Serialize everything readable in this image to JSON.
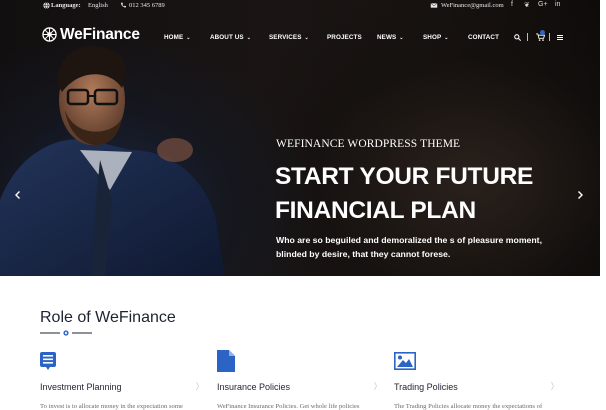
{
  "topbar": {
    "language_label": "Language:",
    "language_value": "English",
    "phone": "012 345 6789",
    "email": "WeFinance@gmail.com",
    "social_icons": [
      "facebook-icon",
      "twitter-icon",
      "google-plus-icon",
      "linkedin-icon"
    ],
    "social_glyphs": [
      "f",
      "❦",
      "G+",
      "in"
    ]
  },
  "brand": {
    "name": "WeFinance"
  },
  "nav": {
    "items": [
      {
        "label": "HOME",
        "caret": "⌄"
      },
      {
        "label": "ABOUT US",
        "caret": "⌄"
      },
      {
        "label": "SERVICES",
        "caret": "⌄"
      },
      {
        "label": "PROJECTS",
        "caret": ""
      },
      {
        "label": "NEWS",
        "caret": "⌄"
      },
      {
        "label": "SHOP",
        "caret": "⌄"
      },
      {
        "label": "CONTACT",
        "caret": ""
      }
    ]
  },
  "hero": {
    "subtitle": "WEFINANCE WORDPRESS THEME",
    "title_line1": "START YOUR FUTURE",
    "title_line2": "FINANCIAL PLAN",
    "desc_line1": "Who are so beguiled and demoralized the s of pleasure moment,",
    "desc_line2": "blinded by desire, that they cannot forese."
  },
  "section": {
    "title": "Role of WeFinance",
    "features": [
      {
        "icon": "list-icon",
        "title": "Investment Planning",
        "desc": "To invest is to allocate money in the expectation some"
      },
      {
        "icon": "document-icon",
        "title": "Insurance Policies",
        "desc": "WeFinance Insurance Policies. Get whole life policies"
      },
      {
        "icon": "image-icon",
        "title": "Trading Policies",
        "desc": "The Trading Policies allocate money the expectations of"
      }
    ]
  },
  "colors": {
    "accent": "#2b64c5",
    "dark_text": "#1e2330",
    "hero_bg": "#15110f"
  }
}
